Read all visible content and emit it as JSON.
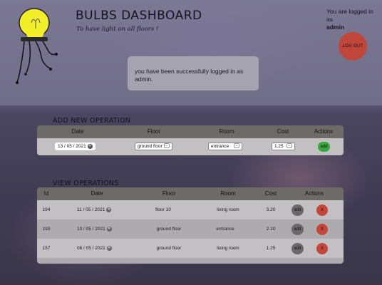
{
  "header": {
    "title": "BULBS DASHBOARD",
    "subtitle": "To have light on all floors !",
    "user_prefix": "You are logged in as",
    "username": "admin",
    "logout_label": "LOG OUT"
  },
  "alert": {
    "message": "you have been successfully logged in as admin."
  },
  "add_section": {
    "title": "ADD NEW OPERATION",
    "columns": [
      "Date",
      "Floor",
      "Room",
      "Cost",
      "Actions"
    ],
    "date_value": "13 / 05 / 2021",
    "floor_value": "ground floor",
    "room_value": "entrance",
    "cost_value": "1.25",
    "add_label": "add"
  },
  "view_section": {
    "title": "VIEW OPERATIONS",
    "columns": [
      "Id",
      "Date",
      "Floor",
      "Room",
      "Cost",
      "Actions"
    ],
    "edit_label": "edit",
    "delete_label": "X",
    "rows": [
      {
        "id": "194",
        "date": "11 / 05 / 2021",
        "floor": "floor 10",
        "room": "living room",
        "cost": "3.20"
      },
      {
        "id": "193",
        "date": "10 / 05 / 2021",
        "floor": "ground floor",
        "room": "entrance",
        "cost": "2.10"
      },
      {
        "id": "157",
        "date": "06 / 05 / 2021",
        "floor": "ground floor",
        "room": "living room",
        "cost": "1.25"
      }
    ]
  },
  "colors": {
    "accent_red": "#c0463a",
    "accent_green": "#3aa640",
    "bulb_yellow": "#f2ee2a"
  }
}
